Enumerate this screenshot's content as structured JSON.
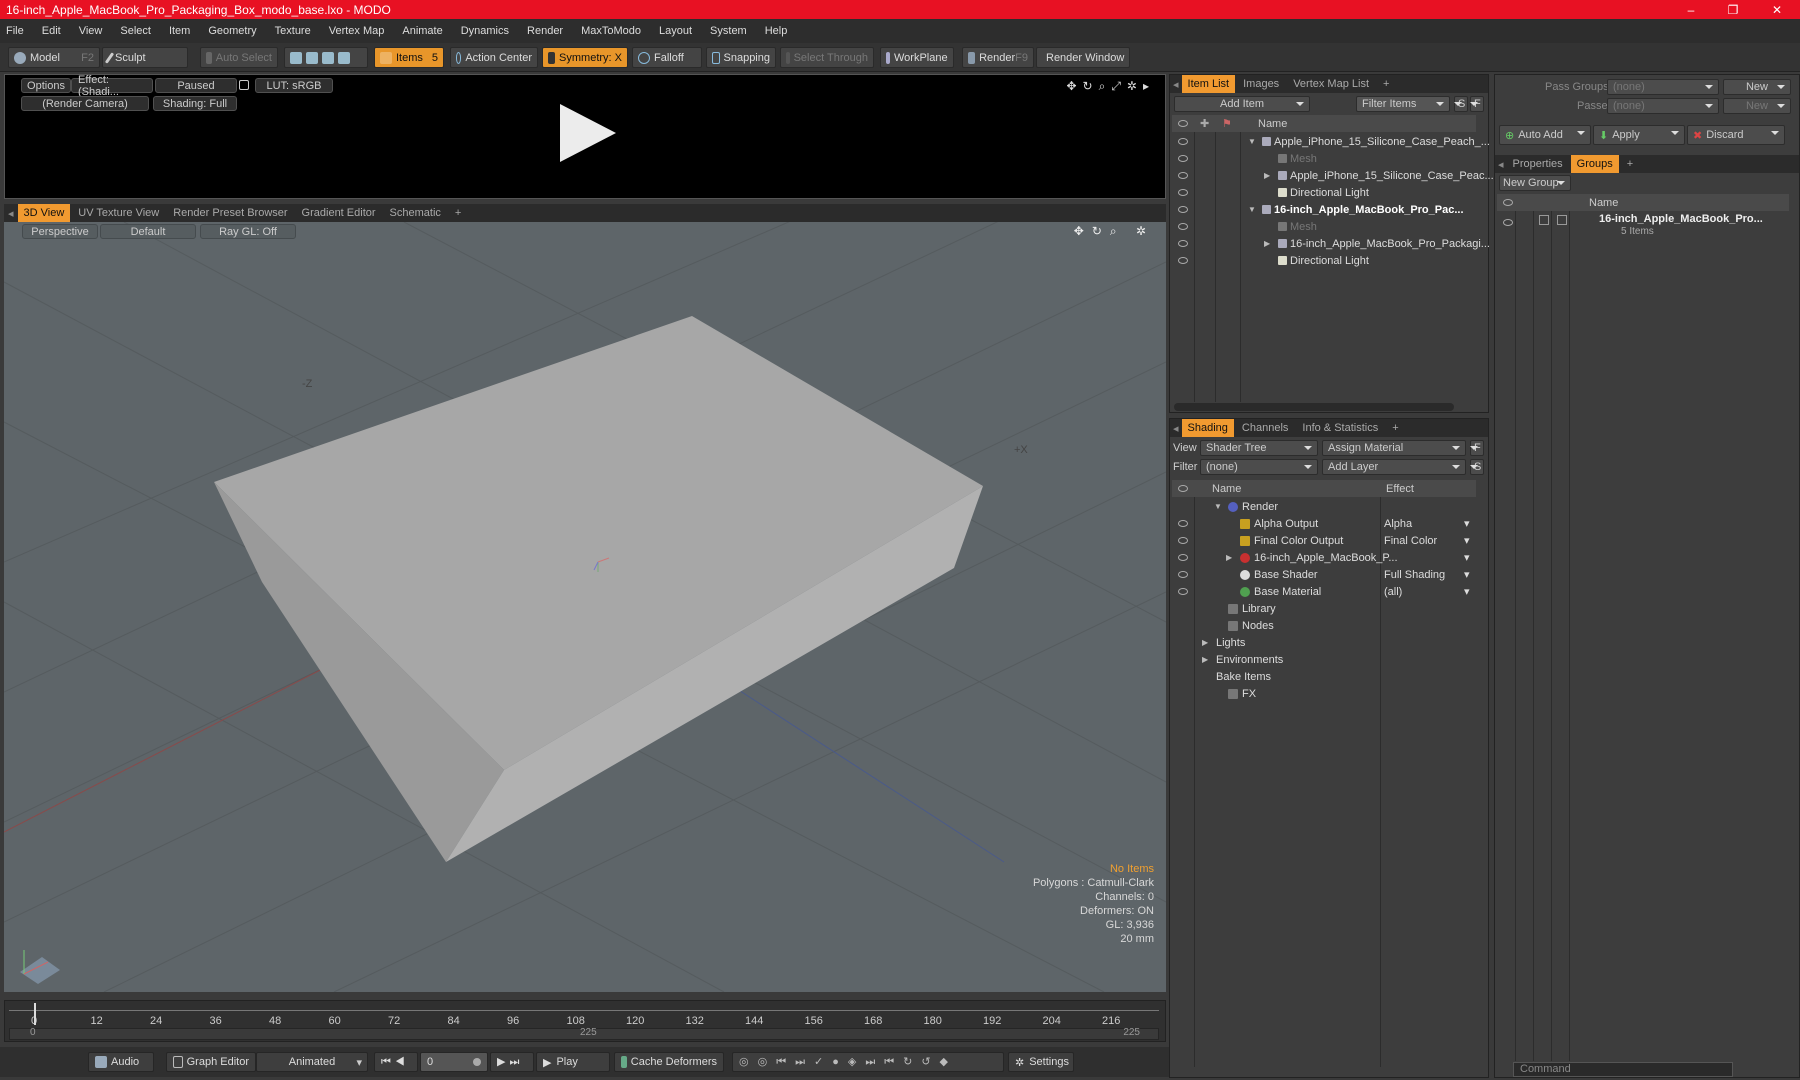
{
  "window": {
    "title": "16-inch_Apple_MacBook_Pro_Packaging_Box_modo_base.lxo - MODO",
    "minimize": "–",
    "maximize": "❐",
    "close": "✕"
  },
  "menu": [
    "File",
    "Edit",
    "View",
    "Select",
    "Item",
    "Geometry",
    "Texture",
    "Vertex Map",
    "Animate",
    "Dynamics",
    "Render",
    "MaxToModo",
    "Layout",
    "System",
    "Help"
  ],
  "toolbar": {
    "model": "Model",
    "model_key": "F2",
    "sculpt": "Sculpt",
    "auto_select": "Auto Select",
    "items": "Items",
    "items_key": "5",
    "action_center": "Action Center",
    "symmetry": "Symmetry: X",
    "falloff": "Falloff",
    "snapping": "Snapping",
    "select_through": "Select Through",
    "workplane": "WorkPlane",
    "render": "Render",
    "render_key": "F9",
    "render_window": "Render Window"
  },
  "preview": {
    "options": "Options",
    "effect": "Effect: (Shadi...",
    "paused": "Paused",
    "lut": "LUT: sRGB",
    "camera": "(Render Camera)",
    "shading": "Shading: Full"
  },
  "viewtabs": [
    "3D View",
    "UV Texture View",
    "Render Preset Browser",
    "Gradient Editor",
    "Schematic",
    "+"
  ],
  "viewport": {
    "perspective": "Perspective",
    "default": "Default",
    "raygl": "Ray GL: Off",
    "no_items": "No Items",
    "polygons": "Polygons : Catmull-Clark",
    "channels": "Channels: 0",
    "deformers": "Deformers: ON",
    "gl": "GL: 3,936",
    "size": "20 mm",
    "axis_z": "-Z",
    "axis_x": "+X"
  },
  "timeline": {
    "ticks": [
      "0",
      "12",
      "24",
      "36",
      "48",
      "60",
      "72",
      "84",
      "96",
      "108",
      "120",
      "132",
      "144",
      "156",
      "168",
      "180",
      "192",
      "204",
      "216"
    ],
    "start": "0",
    "mid": "225",
    "end": "225"
  },
  "bottom": {
    "audio": "Audio",
    "graph_editor": "Graph Editor",
    "animated": "Animated",
    "frame": "0",
    "play": "Play",
    "cache": "Cache Deformers",
    "settings": "Settings"
  },
  "itemlist": {
    "tabs": [
      "Item List",
      "Images",
      "Vertex Map List",
      "+"
    ],
    "add_item": "Add Item",
    "filter": "Filter Items",
    "s": "S",
    "f": "F",
    "col_name": "Name",
    "rows": [
      {
        "label": "Apple_iPhone_15_Silicone_Case_Peach_...",
        "bold": false,
        "indent": 0,
        "arrow": "▼"
      },
      {
        "label": "Mesh",
        "bold": false,
        "indent": 1,
        "arrow": "",
        "dim": true
      },
      {
        "label": "Apple_iPhone_15_Silicone_Case_Peac...",
        "bold": false,
        "indent": 1,
        "arrow": "▶"
      },
      {
        "label": "Directional Light",
        "bold": false,
        "indent": 1,
        "arrow": ""
      },
      {
        "label": "16-inch_Apple_MacBook_Pro_Pac...",
        "bold": true,
        "indent": 0,
        "arrow": "▼"
      },
      {
        "label": "Mesh",
        "bold": false,
        "indent": 1,
        "arrow": "",
        "dim": true
      },
      {
        "label": "16-inch_Apple_MacBook_Pro_Packagi...",
        "bold": false,
        "indent": 1,
        "arrow": "▶"
      },
      {
        "label": "Directional Light",
        "bold": false,
        "indent": 1,
        "arrow": ""
      }
    ]
  },
  "shading": {
    "tabs": [
      "Shading",
      "Channels",
      "Info & Statistics",
      "+"
    ],
    "view_label": "View",
    "view_value": "Shader Tree",
    "assign": "Assign Material",
    "filter_label": "Filter",
    "filter_value": "(none)",
    "add_layer": "Add Layer",
    "f": "F",
    "s": "S",
    "col_name": "Name",
    "col_effect": "Effect",
    "rows": [
      {
        "label": "Render",
        "effect": "",
        "indent": 0,
        "arrow": "▼"
      },
      {
        "label": "Alpha Output",
        "effect": "Alpha",
        "indent": 1,
        "arrow": ""
      },
      {
        "label": "Final Color Output",
        "effect": "Final Color",
        "indent": 1,
        "arrow": ""
      },
      {
        "label": "16-inch_Apple_MacBook_P...",
        "effect": "",
        "indent": 1,
        "arrow": "▶"
      },
      {
        "label": "Base Shader",
        "effect": "Full Shading",
        "indent": 1,
        "arrow": ""
      },
      {
        "label": "Base Material",
        "effect": "(all)",
        "indent": 1,
        "arrow": ""
      },
      {
        "label": "Library",
        "effect": "",
        "indent": 0,
        "arrow": ""
      },
      {
        "label": "Nodes",
        "effect": "",
        "indent": 0,
        "arrow": ""
      },
      {
        "label": "Lights",
        "effect": "",
        "indent": -1,
        "arrow": "▶"
      },
      {
        "label": "Environments",
        "effect": "",
        "indent": -1,
        "arrow": "▶"
      },
      {
        "label": "Bake Items",
        "effect": "",
        "indent": -1,
        "arrow": ""
      },
      {
        "label": "FX",
        "effect": "",
        "indent": 0,
        "arrow": ""
      }
    ]
  },
  "groups": {
    "pass_groups": "Pass Groups",
    "passes": "Passes",
    "none": "(none)",
    "new": "New",
    "auto_add": "Auto Add",
    "apply": "Apply",
    "discard": "Discard",
    "tabs": [
      "Properties",
      "Groups",
      "+"
    ],
    "new_group": "New Group",
    "col_name": "Name",
    "group_name": "16-inch_Apple_MacBook_Pro...",
    "group_count": "5 Items",
    "command": "Command"
  }
}
